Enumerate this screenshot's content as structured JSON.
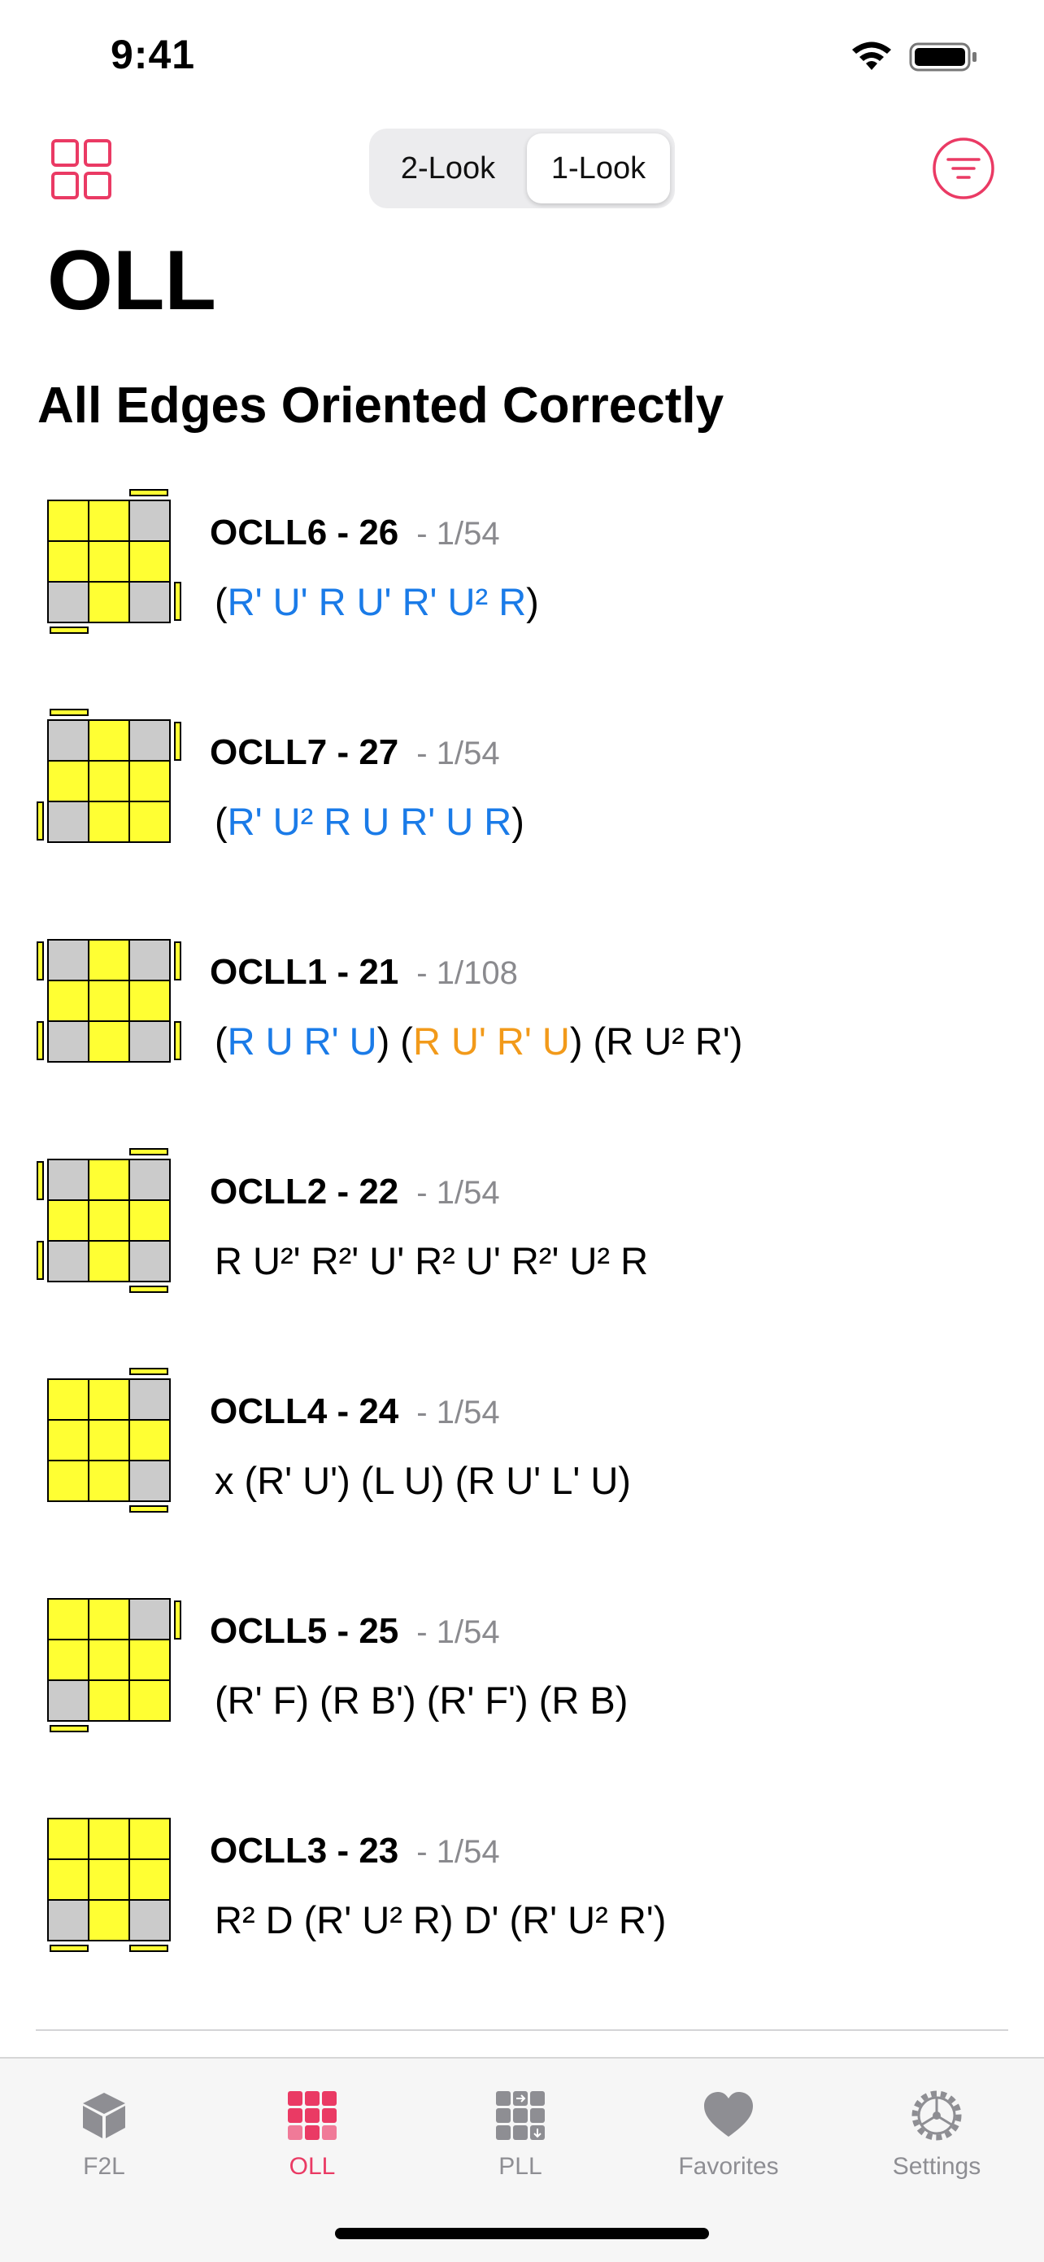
{
  "status": {
    "time": "9:41"
  },
  "header": {
    "segments": [
      "2-Look",
      "1-Look"
    ],
    "selected_segment": "1-Look",
    "grid_icon": "grid-icon",
    "filter_icon": "filter-icon"
  },
  "page_title": "OLL",
  "section_title": "All Edges Oriented Correctly",
  "colors": {
    "accent": "#ea3a64",
    "blue": "#1a7be8",
    "orange": "#f29a1a",
    "yellow": "#ffff33",
    "gray": "#cbcbcb"
  },
  "cases": [
    {
      "name": "OCLL6 - 26",
      "prob": "- 1/54",
      "alg": [
        {
          "t": "("
        },
        {
          "t": "R' U' R U' R' U² R",
          "c": "blue"
        },
        {
          "t": ")"
        }
      ],
      "grid": [
        1,
        1,
        0,
        1,
        1,
        1,
        0,
        1,
        0
      ],
      "stickers": [
        "top-right",
        "right-bottom",
        "bottom-left"
      ]
    },
    {
      "name": "OCLL7 - 27",
      "prob": "- 1/54",
      "alg": [
        {
          "t": "("
        },
        {
          "t": "R' U² R U R' U R",
          "c": "blue"
        },
        {
          "t": ")"
        }
      ],
      "grid": [
        0,
        1,
        0,
        1,
        1,
        1,
        0,
        1,
        1
      ],
      "stickers": [
        "top-left",
        "right-top",
        "left-bottom"
      ]
    },
    {
      "name": "OCLL1 - 21",
      "prob": "- 1/108",
      "alg": [
        {
          "t": "("
        },
        {
          "t": "R U R' U",
          "c": "blue"
        },
        {
          "t": ") ("
        },
        {
          "t": "R U' R' U",
          "c": "orange"
        },
        {
          "t": ") (R U² R')"
        }
      ],
      "grid": [
        0,
        1,
        0,
        1,
        1,
        1,
        0,
        1,
        0
      ],
      "stickers": [
        "left-top",
        "left-bottom",
        "right-top",
        "right-bottom"
      ]
    },
    {
      "name": "OCLL2 - 22",
      "prob": "- 1/54",
      "alg": [
        {
          "t": "R U²' R²' U' R² U' R²' U² R"
        }
      ],
      "grid": [
        0,
        1,
        0,
        1,
        1,
        1,
        0,
        1,
        0
      ],
      "stickers": [
        "left-top",
        "left-bottom",
        "top-right",
        "bottom-right"
      ]
    },
    {
      "name": "OCLL4 - 24",
      "prob": "- 1/54",
      "alg": [
        {
          "t": "x (R' U') (L U) (R U' L' U)"
        }
      ],
      "grid": [
        1,
        1,
        0,
        1,
        1,
        1,
        1,
        1,
        0
      ],
      "stickers": [
        "top-right",
        "bottom-right"
      ]
    },
    {
      "name": "OCLL5 - 25",
      "prob": "- 1/54",
      "alg": [
        {
          "t": "(R' F) (R B') (R' F') (R B)"
        }
      ],
      "grid": [
        1,
        1,
        0,
        1,
        1,
        1,
        0,
        1,
        1
      ],
      "stickers": [
        "right-top",
        "bottom-left"
      ]
    },
    {
      "name": "OCLL3 - 23",
      "prob": "- 1/54",
      "alg": [
        {
          "t": "R² D (R' U² R) D' (R' U² R')"
        }
      ],
      "grid": [
        1,
        1,
        1,
        1,
        1,
        1,
        0,
        1,
        0
      ],
      "stickers": [
        "bottom-left",
        "bottom-right"
      ]
    }
  ],
  "tabs": [
    {
      "label": "F2L",
      "icon": "cube-icon",
      "active": false
    },
    {
      "label": "OLL",
      "icon": "oll-grid-icon",
      "active": true
    },
    {
      "label": "PLL",
      "icon": "pll-grid-icon",
      "active": false
    },
    {
      "label": "Favorites",
      "icon": "heart-icon",
      "active": false
    },
    {
      "label": "Settings",
      "icon": "gear-icon",
      "active": false
    }
  ]
}
